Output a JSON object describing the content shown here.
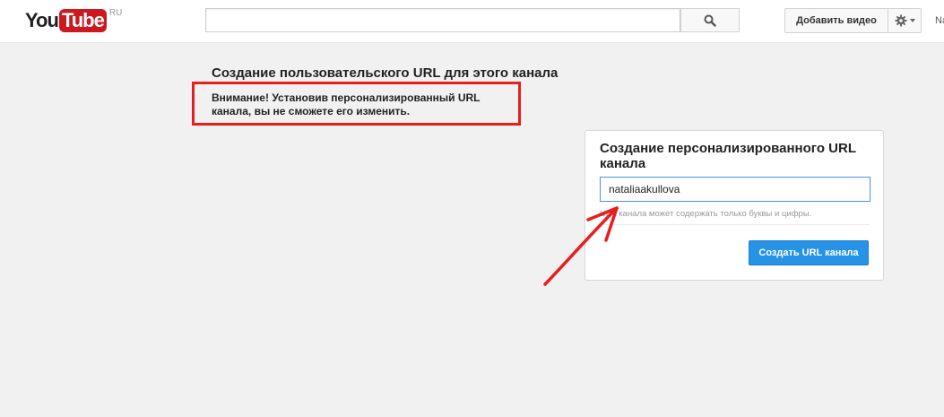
{
  "masthead": {
    "logo_you": "You",
    "logo_tube": "Tube",
    "logo_region": "RU",
    "search_value": "",
    "upload_label": "Добавить видео",
    "user_truncated": "Na",
    "icons": [
      "search-icon",
      "gear-icon",
      "caret-down-icon"
    ]
  },
  "page": {
    "title": "Создание пользовательского URL для этого канала",
    "warning": "Внимание! Установив персонализированный URL канала, вы не сможете его изменить."
  },
  "panel": {
    "title": "Создание персонализированного URL канала",
    "input_value": "nataliaakullova",
    "hint": "URL канала может содержать только буквы и цифры.",
    "create_button": "Создать URL канала"
  },
  "colors": {
    "brand_red": "#cc181e",
    "annotation_red": "#e81d1d",
    "primary_button": "#2793e6",
    "focus_border": "#4d90fe"
  }
}
